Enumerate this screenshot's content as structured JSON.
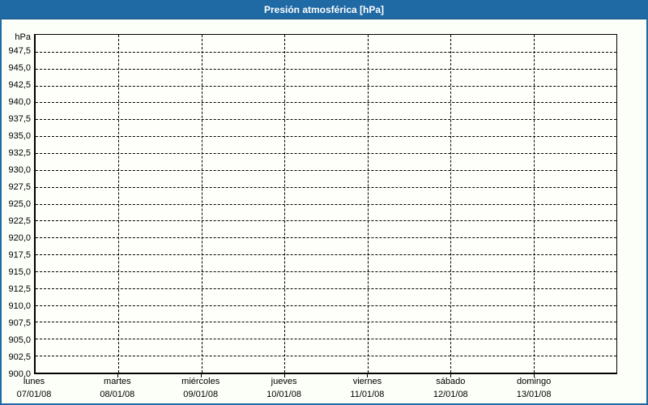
{
  "title": "Presión atmosférica [hPa]",
  "colors": {
    "accent": "#1f6aa5",
    "titlebar_text": "#ffffff",
    "background": "#fcfef8",
    "plot_background": "#fefffb",
    "grid": "#000000",
    "text": "#000000"
  },
  "chart_data": {
    "type": "line",
    "title": "Presión atmosférica [hPa]",
    "ylabel_unit": "hPa",
    "ylim": [
      900,
      950
    ],
    "ytick_step": 2.5,
    "grid": "dashed",
    "legend": "none",
    "yticks": [
      "947,5",
      "945,0",
      "942,5",
      "940,0",
      "937,5",
      "935,0",
      "932,5",
      "930,0",
      "927,5",
      "925,0",
      "922,5",
      "920,0",
      "917,5",
      "915,0",
      "912,5",
      "910,0",
      "907,5",
      "905,0",
      "902,5",
      "900,0"
    ],
    "x_categories": [
      {
        "day": "lunes",
        "date": "07/01/08"
      },
      {
        "day": "martes",
        "date": "08/01/08"
      },
      {
        "day": "miércoles",
        "date": "09/01/08"
      },
      {
        "day": "jueves",
        "date": "10/01/08"
      },
      {
        "day": "viernes",
        "date": "11/01/08"
      },
      {
        "day": "sábado",
        "date": "12/01/08"
      },
      {
        "day": "domingo",
        "date": "13/01/08"
      }
    ],
    "series": []
  }
}
